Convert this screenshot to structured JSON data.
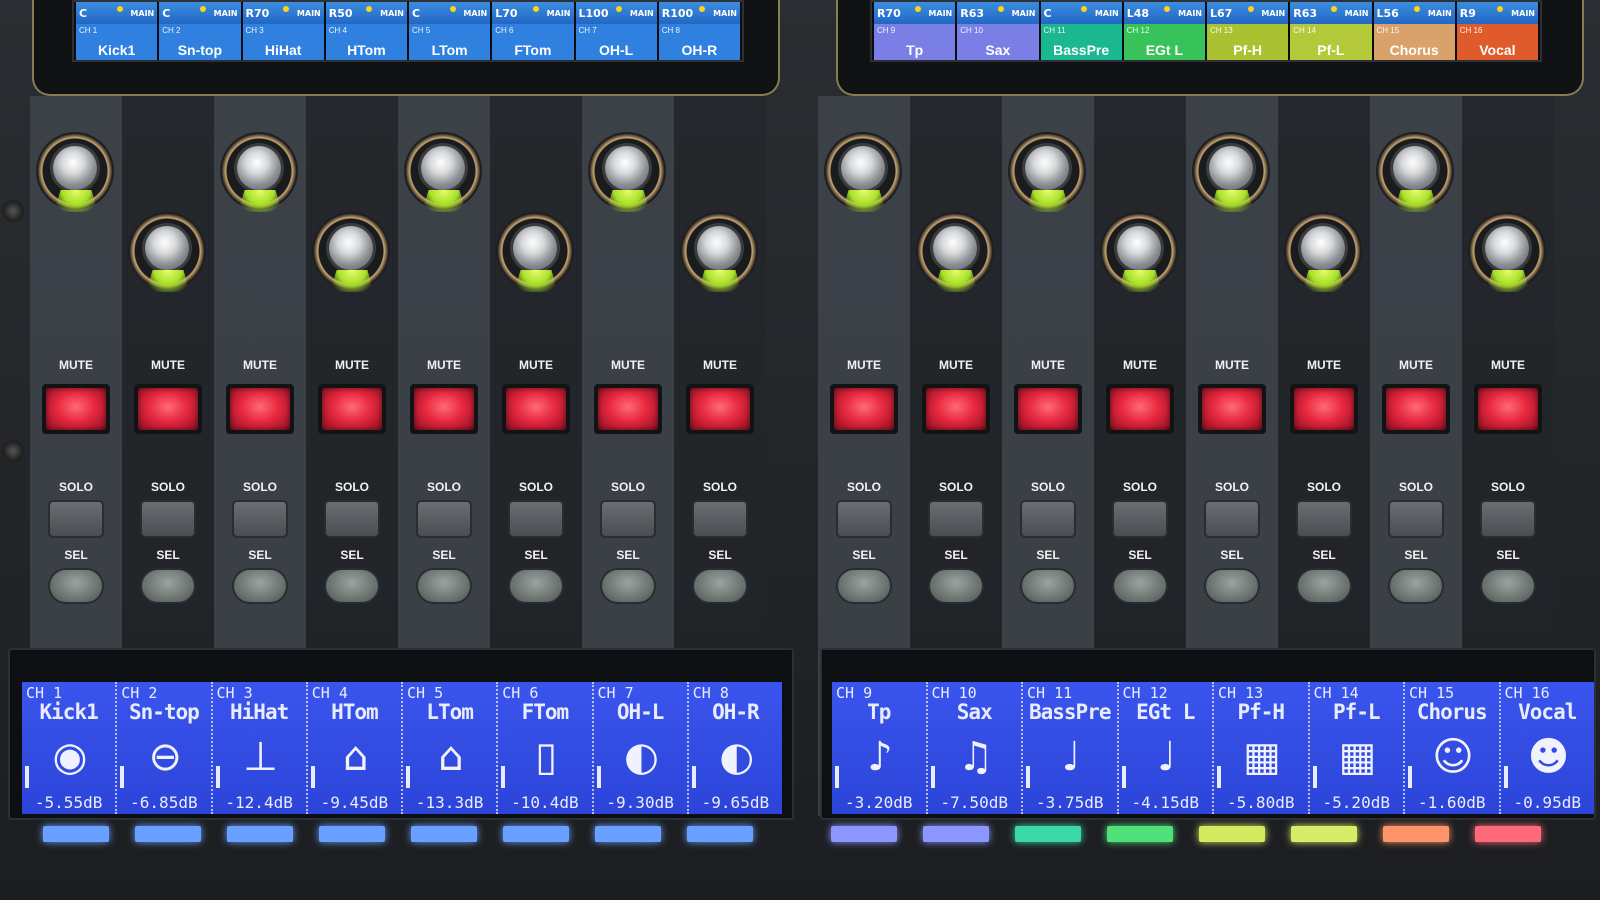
{
  "channels": [
    {
      "ch": "CH 1",
      "name": "Kick1",
      "top_ch": "CH 1",
      "pan": "C",
      "main": "MAIN",
      "db": "-5.55dB",
      "icon": "kick-drum-icon",
      "icon_glyph": "◉",
      "led_color": "#6aa0ff",
      "top_color": "#2f80df"
    },
    {
      "ch": "CH 2",
      "name": "Sn-top",
      "top_ch": "CH 2",
      "pan": "C",
      "main": "MAIN",
      "db": "-6.85dB",
      "icon": "snare-drum-icon",
      "icon_glyph": "⊖",
      "led_color": "#6aa0ff",
      "top_color": "#2f80df"
    },
    {
      "ch": "CH 3",
      "name": "HiHat",
      "top_ch": "CH 3",
      "pan": "R70",
      "main": "MAIN",
      "db": "-12.4dB",
      "icon": "hihat-icon",
      "icon_glyph": "⊥",
      "led_color": "#6aa0ff",
      "top_color": "#2f80df"
    },
    {
      "ch": "CH 4",
      "name": "HTom",
      "top_ch": "CH 4",
      "pan": "R50",
      "main": "MAIN",
      "db": "-9.45dB",
      "icon": "tom-drum-icon",
      "icon_glyph": "⌂",
      "led_color": "#6aa0ff",
      "top_color": "#2f80df"
    },
    {
      "ch": "CH 5",
      "name": "LTom",
      "top_ch": "CH 5",
      "pan": "C",
      "main": "MAIN",
      "db": "-13.3dB",
      "icon": "tom-drum-icon",
      "icon_glyph": "⌂",
      "led_color": "#6aa0ff",
      "top_color": "#2f80df"
    },
    {
      "ch": "CH 6",
      "name": "FTom",
      "top_ch": "CH 6",
      "pan": "L70",
      "main": "MAIN",
      "db": "-10.4dB",
      "icon": "floor-tom-icon",
      "icon_glyph": "▯",
      "led_color": "#6aa0ff",
      "top_color": "#2f80df"
    },
    {
      "ch": "CH 7",
      "name": "OH-L",
      "top_ch": "CH 7",
      "pan": "L100",
      "main": "MAIN",
      "db": "-9.30dB",
      "icon": "cymbal-icon",
      "icon_glyph": "◐",
      "led_color": "#6aa0ff",
      "top_color": "#2f80df"
    },
    {
      "ch": "CH 8",
      "name": "OH-R",
      "top_ch": "CH 8",
      "pan": "R100",
      "main": "MAIN",
      "db": "-9.65dB",
      "icon": "cymbal-icon",
      "icon_glyph": "◐",
      "led_color": "#6aa0ff",
      "top_color": "#2f80df"
    },
    {
      "ch": "CH 9",
      "name": "Tp",
      "top_ch": "CH 9",
      "pan": "R70",
      "main": "MAIN",
      "db": "-3.20dB",
      "icon": "trumpet-icon",
      "icon_glyph": "♪",
      "led_color": "#8c96ff",
      "top_color": "#7a7fe6"
    },
    {
      "ch": "CH 10",
      "name": "Sax",
      "top_ch": "CH 10",
      "pan": "R63",
      "main": "MAIN",
      "db": "-7.50dB",
      "icon": "saxophone-icon",
      "icon_glyph": "♫",
      "led_color": "#8c96ff",
      "top_color": "#7a7fe6"
    },
    {
      "ch": "CH 11",
      "name": "BassPre",
      "top_ch": "CH 11",
      "pan": "C",
      "main": "MAIN",
      "db": "-3.75dB",
      "icon": "bass-guitar-icon",
      "icon_glyph": "♩",
      "led_color": "#3ad8a8",
      "top_color": "#1ab790"
    },
    {
      "ch": "CH 12",
      "name": "EGt L",
      "top_ch": "CH 12",
      "pan": "L48",
      "main": "MAIN",
      "db": "-4.15dB",
      "icon": "electric-guitar-icon",
      "icon_glyph": "♩",
      "led_color": "#4fe07a",
      "top_color": "#38c25a"
    },
    {
      "ch": "CH 13",
      "name": "Pf-H",
      "top_ch": "CH 13",
      "pan": "L67",
      "main": "MAIN",
      "db": "-5.80dB",
      "icon": "piano-icon",
      "icon_glyph": "▦",
      "led_color": "#d4e860",
      "top_color": "#aac232"
    },
    {
      "ch": "CH 14",
      "name": "Pf-L",
      "top_ch": "CH 14",
      "pan": "R63",
      "main": "MAIN",
      "db": "-5.20dB",
      "icon": "piano-icon",
      "icon_glyph": "▦",
      "led_color": "#d8ec6a",
      "top_color": "#b4c93a"
    },
    {
      "ch": "CH 15",
      "name": "Chorus",
      "top_ch": "CH 15",
      "pan": "L56",
      "main": "MAIN",
      "db": "-1.60dB",
      "icon": "chorus-icon",
      "icon_glyph": "☺",
      "led_color": "#ff9468",
      "top_color": "#d9a26b"
    },
    {
      "ch": "CH 16",
      "name": "Vocal",
      "top_ch": "CH 16",
      "pan": "R9",
      "main": "MAIN",
      "db": "-0.95dB",
      "icon": "vocal-icon",
      "icon_glyph": "☻",
      "led_color": "#ff6a7a",
      "top_color": "#e05b2c"
    }
  ],
  "labels": {
    "mute": "MUTE",
    "solo": "SOLO",
    "sel": "SEL"
  }
}
